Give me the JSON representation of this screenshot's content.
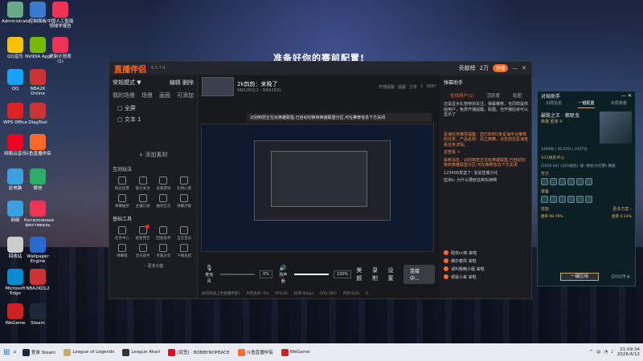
{
  "desktop": {
    "banner": "准备好你的赛前配置!",
    "icons": [
      {
        "label": "Administrato",
        "color": "#6a8"
      },
      {
        "label": "控制面板",
        "color": "#3a7acc"
      },
      {
        "label": "中国人工智能领域学报告",
        "color": "#e35"
      },
      {
        "label": "QQ音乐",
        "color": "#f4c20d"
      },
      {
        "label": "NVIDIA App",
        "color": "#76b900"
      },
      {
        "label": "更新计划表(1)",
        "color": "#e35"
      },
      {
        "label": "QQ",
        "color": "#1aa0ff"
      },
      {
        "label": "NBA2K Online",
        "color": "#c33"
      },
      {
        "label": "WPS Office",
        "color": "#d22"
      },
      {
        "label": "DiagTool",
        "color": "#c33"
      },
      {
        "label": "网易云音乐",
        "color": "#e02"
      },
      {
        "label": "斗鱼直播伴侣",
        "color": "#ff6a2a"
      },
      {
        "label": "此电脑",
        "color": "#3aa0e0"
      },
      {
        "label": "微信",
        "color": "#2aae67"
      },
      {
        "label": "网络",
        "color": "#3aa0e0"
      },
      {
        "label": "Каталожные фестиваль",
        "color": "#e35"
      },
      {
        "label": "回收站",
        "color": "#ccc"
      },
      {
        "label": "Wallpaper Engine",
        "color": "#2a6ad0"
      },
      {
        "label": "Microsoft Edge",
        "color": "#0a8ad0"
      },
      {
        "label": "NBA2KOL2",
        "color": "#c33"
      },
      {
        "label": "WeGame",
        "color": "#c22"
      },
      {
        "label": "Steam",
        "color": "#1b2838"
      }
    ]
  },
  "app": {
    "logo": "直播伴侣",
    "version": "6.5.7.4",
    "title_links": [
      "贡献榜",
      "2万",
      "开播"
    ],
    "left": {
      "mode": "常规模式 ▼",
      "edit": "编辑",
      "delete": "删除",
      "scene_label": "我的场景",
      "scene_tabs": [
        "场景",
        "画面",
        "可添加"
      ],
      "sources": [
        "全屏",
        "文本 1"
      ],
      "add_source": "+ 添加素材",
      "interactive_title": "互动玩法",
      "interactive": [
        "粉丝投票",
        "吸引关注",
        "竞猜游戏",
        "礼物心愿",
        "弹幕抽奖",
        "主播口述",
        "抽奖红包",
        "弹幕点歌"
      ],
      "basic_title": "基础工具",
      "basic": [
        "任务中心",
        "星座预告",
        "回放助手",
        "正在音乐",
        "弹幕窗",
        "音乐助手",
        "专属分享",
        "下播总结"
      ],
      "more": "··· 更多功能"
    },
    "preview": {
      "room_title": "2k韵韵：来晚了",
      "room_sub": "NBA2KOL2 - NBA2KOL",
      "room_stats": [
        "开播提醒",
        "提醒",
        "分享",
        "0",
        "3687"
      ],
      "notice": "识别到您正在玩英雄联盟,已自动切换到英雄联盟分区,可在推荐信息下方关闭",
      "mic_label": "麦克风",
      "speaker_label": "扬声器",
      "mic_value": "0%",
      "speaker_value": "100%",
      "tools": [
        "美颜",
        "录制",
        "设置"
      ],
      "start_button": "连接中...",
      "status": [
        "如何快速上手直播伴侣?",
        "声音丢失: 0%",
        "FPS:60",
        "码率:0kbps",
        "CPU:18%",
        "内存:62%",
        "0"
      ]
    },
    "assistant": {
      "title": "弹幕助手",
      "tabs": [
        "在线用户(1)",
        "活跃度",
        "贴图"
      ],
      "intro": "还是显示礼物特别关注，弹幕推荐，也同样提供给用户，免费开播提醒，贴图，也开播后就可以显示了",
      "messages": [
        {
          "text": "星海任务推举提醒：您已收到1条星海平台推荐的任务，产品名称：风之雨舞，点击前往星海查看任务详情。",
          "hl": true
        },
        {
          "text": "去查看 >",
          "hl": true
        },
        {
          "text": "系统消息：识别到您正在玩英雄联盟,已自动切换到英雄联盟分区,可在推荐信息下方关闭",
          "hl": true
        },
        {
          "text": "123456发送了: 说说直播分化",
          "hl": false
        },
        {
          "text": "蓝米k: 为什么要欧这种东西啊",
          "hl": false
        }
      ],
      "chats": [
        "助农cc热 来啦",
        "偶尔春风 来啦",
        "请叫我韩小姐 来啦",
        "现役小来 来啦"
      ]
    }
  },
  "lol_helper": {
    "title": "对局助手",
    "tabs": [
      "对局信息",
      "一键配置",
      "本局英雄"
    ],
    "champion": "破败之王 · 佛耶戈",
    "champion_sub": "英雄 胜率 4",
    "stats": "1269局 | 45.24% | 2437分",
    "rank": "101级别中心",
    "note": "[2026.04]《101级别》级: 继续(大打野) 数据",
    "runes_title": "符文",
    "items_title": "装备",
    "skill_title": "技能",
    "more_label": "更多方案 ›",
    "winrate_a": "胜率 99.76%",
    "winrate_b": "胜率 0.14%",
    "apply_button": "一键应用",
    "auto_label": "自动应用"
  },
  "taskbar": {
    "items": [
      "登录 Steam",
      "League of Legends",
      "League Akari",
      "[双签] · BOBBYNOPEACE",
      "斗鱼直播伴侣",
      "WeGame"
    ],
    "time": "21:09:34",
    "date": "2026/4/12",
    "lang": "中"
  }
}
